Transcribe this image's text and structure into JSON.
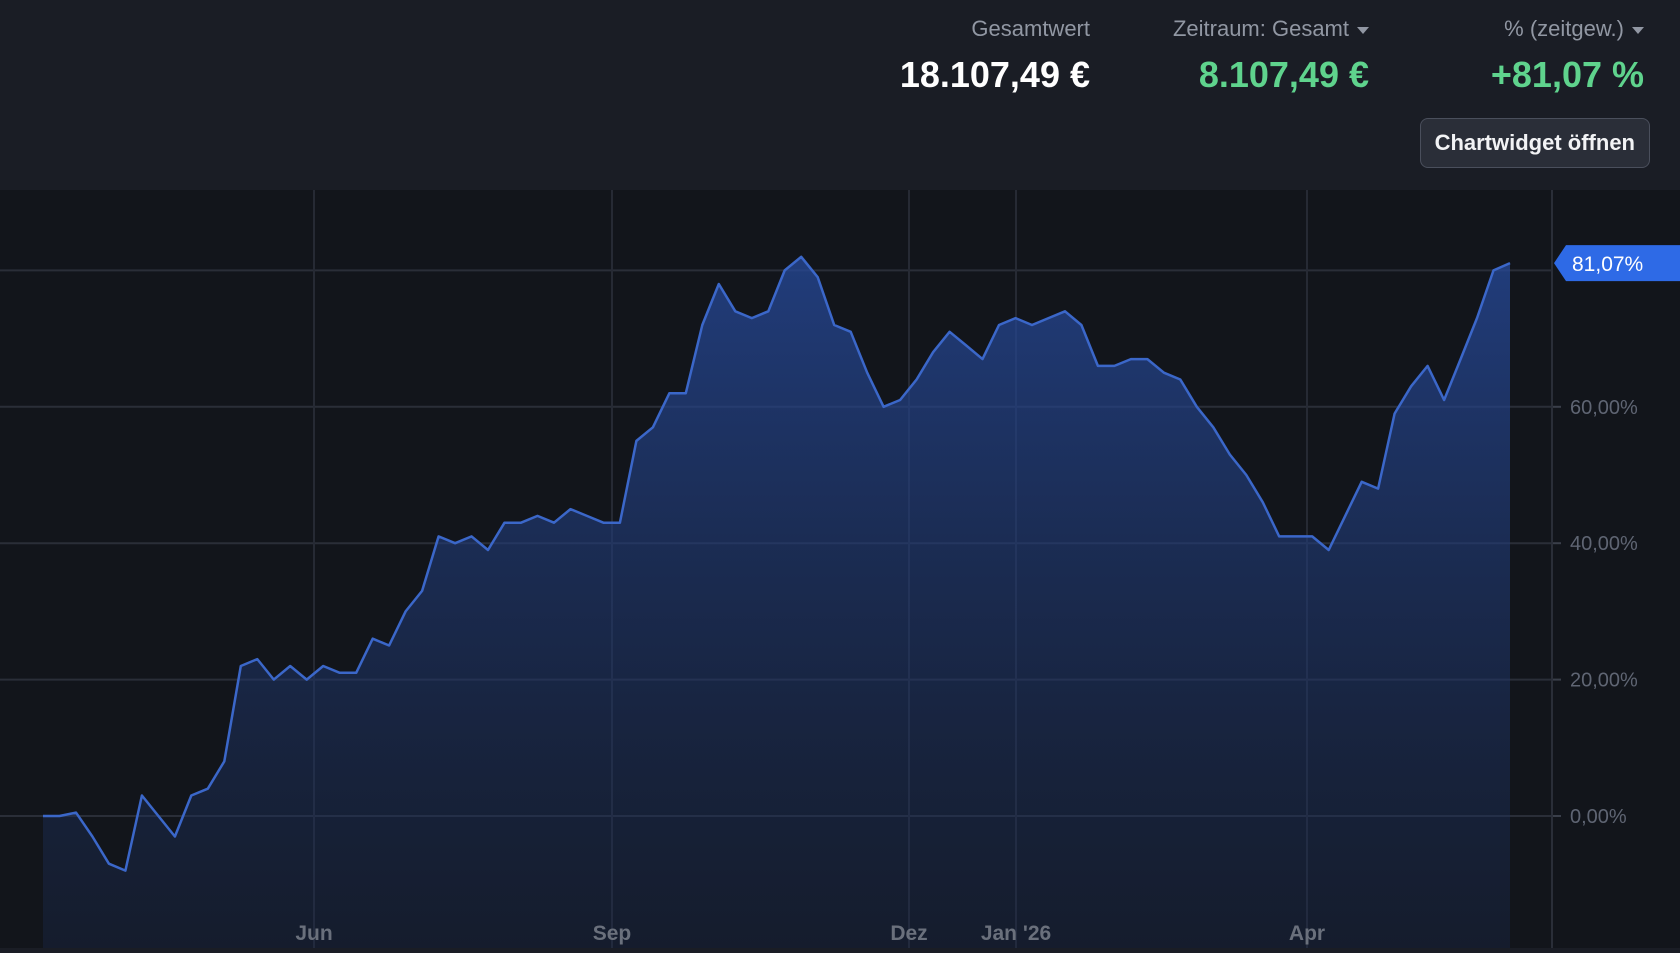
{
  "header": {
    "total": {
      "label": "Gesamtwert",
      "value": "18.107,49 €"
    },
    "period": {
      "label": "Zeitraum: Gesamt",
      "value": "8.107,49 €"
    },
    "percent": {
      "label": "% (zeitgew.)",
      "value": "+81,07 %"
    },
    "open_widget_label": "Chartwidget öffnen"
  },
  "colors": {
    "background": "#1a1d25",
    "chart_background": "#12151b",
    "positive": "#5fd38d",
    "line": "#3b67c9",
    "badge": "#2e6ae6"
  },
  "chart_data": {
    "type": "area",
    "title": "",
    "xlabel": "",
    "ylabel": "",
    "x_ticks": [
      "Jun",
      "Sep",
      "Dez",
      "Jan '26",
      "Apr"
    ],
    "y_ticks": [
      "0,00%",
      "20,00%",
      "40,00%",
      "60,00%"
    ],
    "ylim": [
      -18,
      90
    ],
    "grid": true,
    "current_value_label": "81,07%",
    "series": [
      {
        "values": [
          0,
          0,
          0.5,
          -3,
          -7,
          -8,
          3,
          0,
          -3,
          3,
          4,
          8,
          22,
          23,
          20,
          22,
          20,
          22,
          21,
          21,
          26,
          25,
          30,
          33,
          41,
          40,
          41,
          39,
          43,
          43,
          44,
          43,
          45,
          44,
          43,
          43,
          55,
          57,
          62,
          62,
          72,
          78,
          74,
          73,
          74,
          80,
          82,
          79,
          72,
          71,
          65,
          60,
          61,
          64,
          68,
          71,
          69,
          67,
          72,
          73,
          72,
          73,
          74,
          72,
          66,
          66,
          67,
          67,
          65,
          64,
          60,
          57,
          53,
          50,
          46,
          41,
          41,
          41,
          39,
          44,
          49,
          48,
          59,
          63,
          66,
          61,
          67,
          73,
          80,
          81.07
        ]
      }
    ]
  }
}
